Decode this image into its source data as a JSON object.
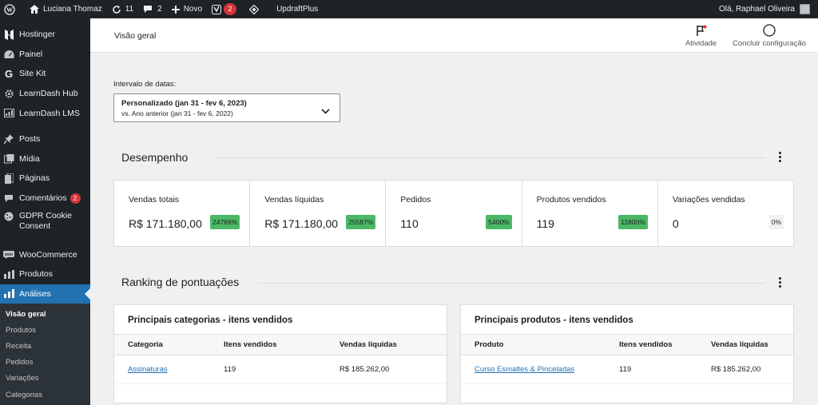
{
  "adminbar": {
    "site_name": "Luciana Thomaz",
    "updates_count": "11",
    "comments_count": "2",
    "new_label": "Novo",
    "yoast_badge": "2",
    "updraft_label": "UpdraftPlus",
    "greeting": "Olá, Raphael Oliveira"
  },
  "sidebar": {
    "items": [
      {
        "label": "Hostinger",
        "icon": "hostinger-icon"
      },
      {
        "label": "Painel",
        "icon": "dashboard-icon"
      },
      {
        "label": "Site Kit",
        "icon": "google-icon"
      },
      {
        "label": "LearnDash Hub",
        "icon": "gear-icon"
      },
      {
        "label": "LearnDash LMS",
        "icon": "learndash-icon"
      },
      {
        "label": "Posts",
        "icon": "pin-icon"
      },
      {
        "label": "Mídia",
        "icon": "media-icon"
      },
      {
        "label": "Páginas",
        "icon": "pages-icon"
      },
      {
        "label": "Comentários",
        "icon": "comment-icon",
        "badge": "2"
      },
      {
        "label": "GDPR Cookie Consent",
        "icon": "cookie-icon"
      },
      {
        "label": "WooCommerce",
        "icon": "woocommerce-icon"
      },
      {
        "label": "Produtos",
        "icon": "products-icon"
      },
      {
        "label": "Análises",
        "icon": "analytics-icon"
      }
    ],
    "submenu": [
      "Visão geral",
      "Produtos",
      "Receita",
      "Pedidos",
      "Variações",
      "Categorias"
    ]
  },
  "header": {
    "title": "Visão geral",
    "activity_label": "Atividade",
    "setup_label": "Concluir configuração"
  },
  "date_range": {
    "label": "Intervalo de datas:",
    "main": "Personalizado (jan 31 - fev 6, 2023)",
    "sub": "vs. Ano anterior (jan 31 - fev 6, 2022)"
  },
  "performance": {
    "title": "Desempenho",
    "cells": [
      {
        "label": "Vendas totais",
        "value": "R$ 171.180,00",
        "delta": "24769%"
      },
      {
        "label": "Vendas líquidas",
        "value": "R$ 171.180,00",
        "delta": "25587%"
      },
      {
        "label": "Pedidos",
        "value": "110",
        "delta": "5400%"
      },
      {
        "label": "Produtos vendidos",
        "value": "119",
        "delta": "11800%"
      },
      {
        "label": "Variações vendidas",
        "value": "0",
        "delta": "0%"
      }
    ]
  },
  "ranking": {
    "title": "Ranking de pontuações",
    "categories": {
      "title": "Principais categorias - itens vendidos",
      "headers": [
        "Categoria",
        "Itens vendidos",
        "Vendas líquidas"
      ],
      "rows": [
        [
          "Assinaturas",
          "119",
          "R$ 185.262,00"
        ]
      ]
    },
    "products": {
      "title": "Principais produtos - itens vendidos",
      "headers": [
        "Produto",
        "Itens vendidos",
        "Vendas líquidas"
      ],
      "rows": [
        [
          "Curso Esmaltes & Pinceladas",
          "119",
          "R$ 185.262,00"
        ]
      ]
    }
  },
  "colors": {
    "admin_dark": "#1d2327",
    "accent_blue": "#2271b1",
    "delta_green": "#4ab866",
    "badge_red": "#d63638"
  }
}
